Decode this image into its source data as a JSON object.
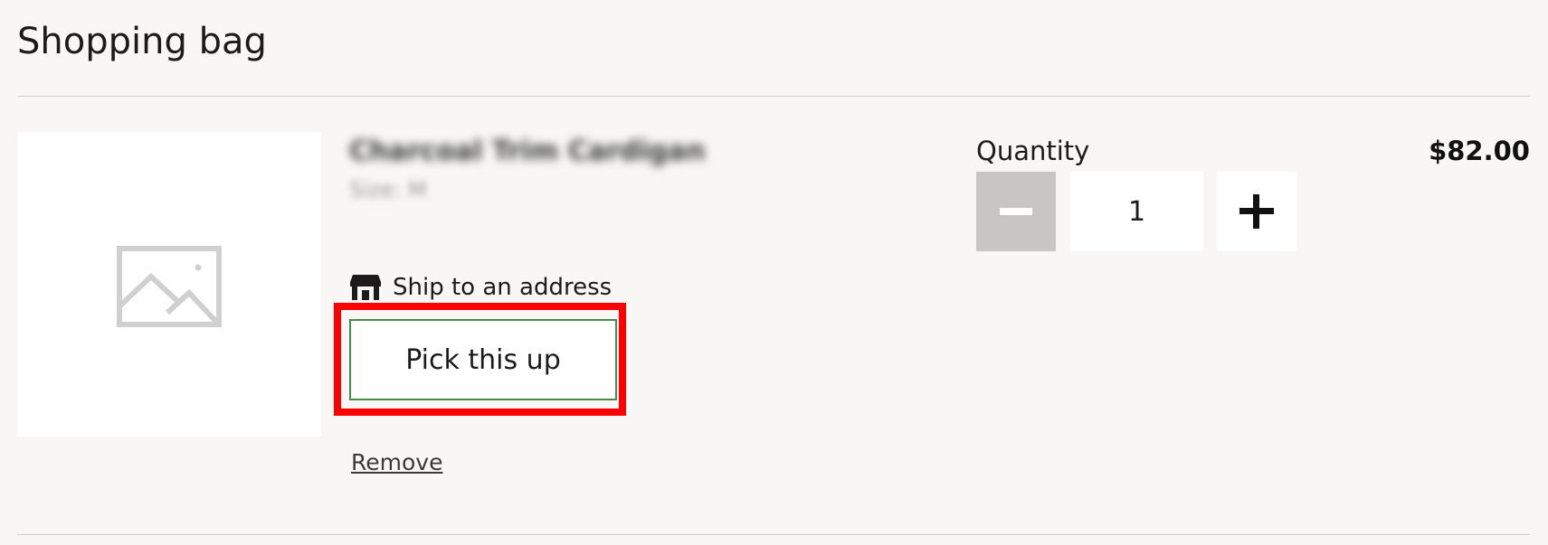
{
  "page": {
    "title": "Shopping bag"
  },
  "item": {
    "name": "Charcoal Trim Cardigan",
    "size": "Size: M",
    "price": "$82.00",
    "image_icon": "image-placeholder-icon"
  },
  "fulfillment": {
    "ship_label": "Ship to an address",
    "ship_icon": "store-icon",
    "pickup_label": "Pick this up"
  },
  "actions": {
    "remove_label": "Remove"
  },
  "quantity": {
    "label": "Quantity",
    "value": "1",
    "decrease_icon": "minus-icon",
    "increase_icon": "plus-icon"
  },
  "colors": {
    "background": "#f8f7f6",
    "highlight": "#ff0000",
    "pickup_border": "#4a8a4a",
    "disabled_button": "#c8c6c4"
  }
}
